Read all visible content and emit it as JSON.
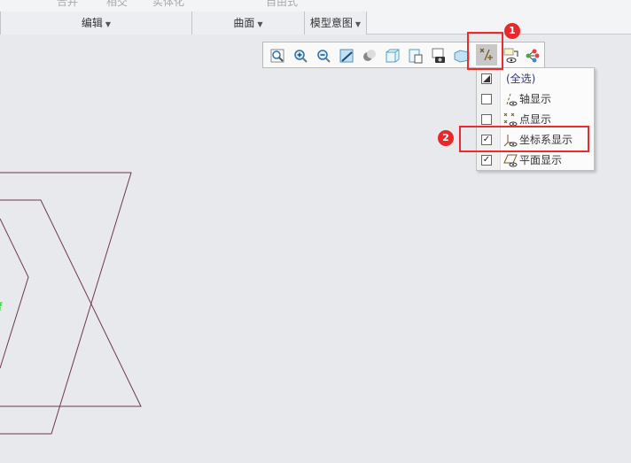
{
  "ribbon": {
    "top_row": [
      "合并",
      "相交",
      "实体化",
      "自由式"
    ],
    "groups": [
      {
        "label": "编辑"
      },
      {
        "label": "曲面"
      },
      {
        "label": "模型意图"
      }
    ]
  },
  "view_toolbar": {
    "icons": [
      "zoom-fit-icon",
      "zoom-in-icon",
      "zoom-out-icon",
      "repaint-icon",
      "display-style-icon",
      "saved-orientations-icon",
      "view-manager-icon",
      "appearance-icon",
      "perspective-icon",
      "datum-display-filter-icon",
      "annotation-display-icon",
      "spin-center-icon"
    ]
  },
  "datum_menu": {
    "items": [
      {
        "label": "(全选)",
        "state": "partial"
      },
      {
        "label": "轴显示",
        "checked": false
      },
      {
        "label": "点显示",
        "checked": false
      },
      {
        "label": "坐标系显示",
        "checked": true
      },
      {
        "label": "平面显示",
        "checked": true
      }
    ]
  },
  "annotations": {
    "badge1": "1",
    "badge2": "2"
  },
  "model": {
    "label_fragment": "f"
  },
  "colors": {
    "highlight": "#ee2b2b",
    "sketch_line": "#6e3b47"
  }
}
